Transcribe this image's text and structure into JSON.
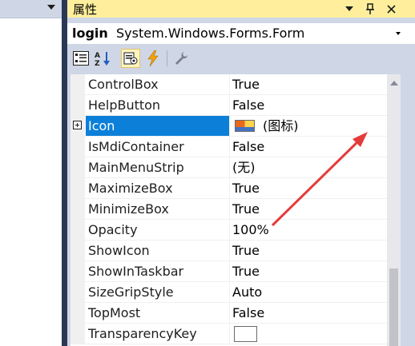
{
  "panel": {
    "title": "属性",
    "buttons": {
      "dropdown": "▾",
      "pin": "🖈",
      "close": "✕"
    }
  },
  "object_selector": {
    "name": "login",
    "type": "System.Windows.Forms.Form"
  },
  "toolbar": {
    "tools": [
      "categorized-icon",
      "alphabetical-icon",
      "properties-icon",
      "events-icon",
      "property-pages-icon"
    ]
  },
  "properties": [
    {
      "name": "ControlBox",
      "value": "True"
    },
    {
      "name": "HelpButton",
      "value": "False"
    },
    {
      "name": "Icon",
      "value": "(图标)"
    },
    {
      "name": "IsMdiContainer",
      "value": "False"
    },
    {
      "name": "MainMenuStrip",
      "value": "(无)"
    },
    {
      "name": "MaximizeBox",
      "value": "True"
    },
    {
      "name": "MinimizeBox",
      "value": "True"
    },
    {
      "name": "Opacity",
      "value": "100%"
    },
    {
      "name": "ShowIcon",
      "value": "True"
    },
    {
      "name": "ShowInTaskbar",
      "value": "True"
    },
    {
      "name": "SizeGripStyle",
      "value": "Auto"
    },
    {
      "name": "TopMost",
      "value": "False"
    },
    {
      "name": "TransparencyKey",
      "value": ""
    }
  ],
  "ellipsis_label": "...",
  "colors": {
    "selection": "#0c7fd9",
    "annotation_arrow": "#e53b3b",
    "titlebar": "#ffef9c"
  }
}
